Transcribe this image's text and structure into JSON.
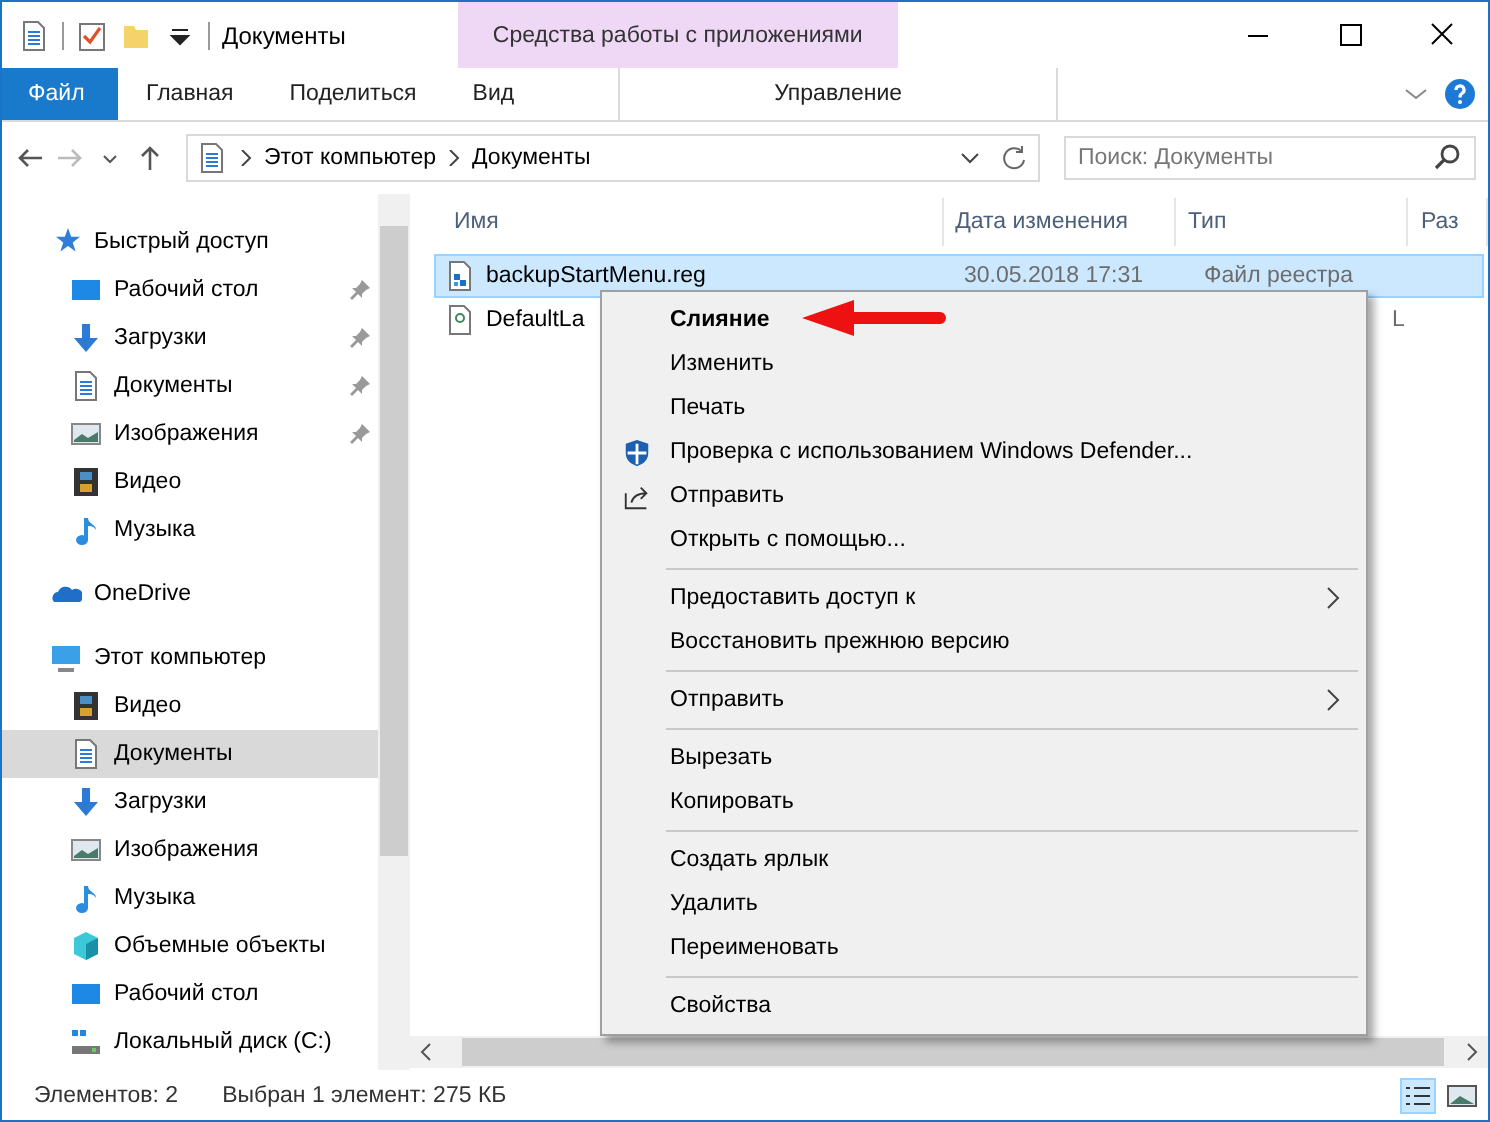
{
  "window": {
    "title": "Документы",
    "context_tab_group": "Средства работы с приложениями"
  },
  "ribbon_tabs": [
    {
      "label": "Файл",
      "kind": "file",
      "selected": false
    },
    {
      "label": "Главная",
      "kind": "tab",
      "selected": false
    },
    {
      "label": "Поделиться",
      "kind": "tab",
      "selected": false
    },
    {
      "label": "Вид",
      "kind": "tab",
      "selected": false
    },
    {
      "label": "Управление",
      "kind": "context",
      "selected": false
    }
  ],
  "address": {
    "path": [
      "Этот компьютер",
      "Документы"
    ]
  },
  "search": {
    "placeholder": "Поиск: Документы"
  },
  "sidebar": {
    "items": [
      {
        "label": "Быстрый доступ",
        "kind": "star",
        "selected": false,
        "children": [
          {
            "label": "Рабочий стол",
            "kind": "desktop",
            "pinned": true,
            "selected": false
          },
          {
            "label": "Загрузки",
            "kind": "download",
            "pinned": true,
            "selected": false
          },
          {
            "label": "Документы",
            "kind": "document",
            "pinned": true,
            "selected": false
          },
          {
            "label": "Изображения",
            "kind": "image",
            "pinned": true,
            "selected": false
          },
          {
            "label": "Видео",
            "kind": "video",
            "pinned": false,
            "selected": false
          },
          {
            "label": "Музыка",
            "kind": "music",
            "pinned": false,
            "selected": false
          }
        ]
      },
      {
        "label": "OneDrive",
        "kind": "cloud",
        "selected": false
      },
      {
        "label": "Этот компьютер",
        "kind": "computer",
        "selected": false,
        "children": [
          {
            "label": "Видео",
            "kind": "video",
            "selected": false
          },
          {
            "label": "Документы",
            "kind": "document",
            "selected": true
          },
          {
            "label": "Загрузки",
            "kind": "download",
            "selected": false
          },
          {
            "label": "Изображения",
            "kind": "image",
            "selected": false
          },
          {
            "label": "Музыка",
            "kind": "music",
            "selected": false
          },
          {
            "label": "Объемные объекты",
            "kind": "cube",
            "selected": false
          },
          {
            "label": "Рабочий стол",
            "kind": "desktop",
            "selected": false
          },
          {
            "label": "Локальный диск (C:)",
            "kind": "drive",
            "selected": false
          }
        ]
      }
    ]
  },
  "table": {
    "columns": [
      "Имя",
      "Дата изменения",
      "Тип",
      "Раз"
    ],
    "rows": [
      {
        "name": "backupStartMenu.reg",
        "date": "30.05.2018 17:31",
        "type": "Файл реестра",
        "kind": "reg",
        "selected": true
      },
      {
        "name": "DefaultLa",
        "date": "",
        "type": "L",
        "kind": "xml",
        "selected": false
      }
    ]
  },
  "context_menu": {
    "items": [
      {
        "kind": "item",
        "label": "Слияние",
        "bold": true
      },
      {
        "kind": "item",
        "label": "Изменить"
      },
      {
        "kind": "item",
        "label": "Печать"
      },
      {
        "kind": "shield",
        "label": "Проверка с использованием Windows Defender..."
      },
      {
        "kind": "share",
        "label": "Отправить"
      },
      {
        "kind": "item",
        "label": "Открыть с помощью..."
      },
      {
        "kind": "separator"
      },
      {
        "kind": "item",
        "label": "Предоставить доступ к",
        "submenu": true
      },
      {
        "kind": "item",
        "label": "Восстановить прежнюю версию"
      },
      {
        "kind": "separator"
      },
      {
        "kind": "item",
        "label": "Отправить",
        "submenu": true
      },
      {
        "kind": "separator"
      },
      {
        "kind": "item",
        "label": "Вырезать"
      },
      {
        "kind": "item",
        "label": "Копировать"
      },
      {
        "kind": "separator"
      },
      {
        "kind": "item",
        "label": "Создать ярлык"
      },
      {
        "kind": "item",
        "label": "Удалить"
      },
      {
        "kind": "item",
        "label": "Переименовать"
      },
      {
        "kind": "separator"
      },
      {
        "kind": "item",
        "label": "Свойства"
      }
    ]
  },
  "status_bar": {
    "count": "Элементов: 2",
    "selection": "Выбран 1 элемент: 275 КБ"
  }
}
